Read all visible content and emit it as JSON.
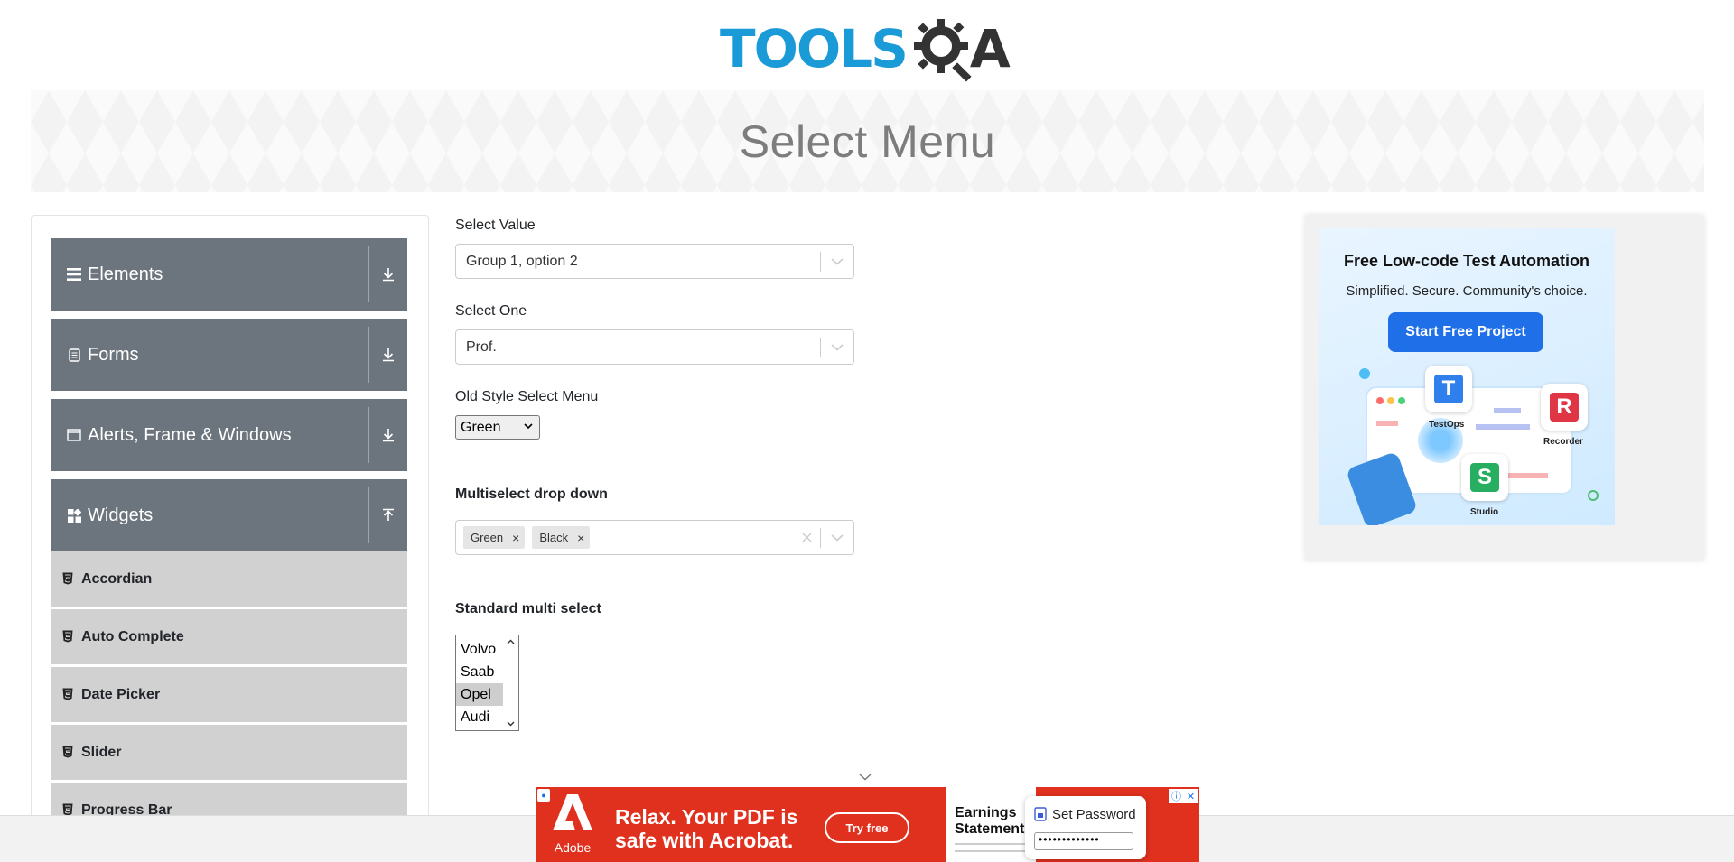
{
  "header": {
    "logo_text": "TOOLS",
    "logo_suffix": "A",
    "page_title": "Select Menu"
  },
  "sidebar": {
    "groups": [
      {
        "label": "Elements",
        "icon": "hamburger-icon",
        "expanded": false
      },
      {
        "label": "Forms",
        "icon": "form-icon",
        "expanded": false
      },
      {
        "label": "Alerts, Frame & Windows",
        "icon": "window-icon",
        "expanded": false
      },
      {
        "label": "Widgets",
        "icon": "widgets-icon",
        "expanded": true
      }
    ],
    "widget_items": [
      "Accordian",
      "Auto Complete",
      "Date Picker",
      "Slider",
      "Progress Bar"
    ]
  },
  "form": {
    "select_value": {
      "label": "Select Value",
      "value": "Group 1, option 2"
    },
    "select_one": {
      "label": "Select One",
      "value": "Prof."
    },
    "old_style": {
      "label": "Old Style Select Menu",
      "value": "Green"
    },
    "multiselect": {
      "label": "Multiselect drop down",
      "chips": [
        "Green",
        "Black"
      ]
    },
    "standard_multi": {
      "label": "Standard multi select",
      "options": [
        "Volvo",
        "Saab",
        "Opel",
        "Audi"
      ],
      "selected": "Opel"
    }
  },
  "ad_right": {
    "title": "Free Low-code Test Automation",
    "subtitle": "Simplified. Secure. Community's choice.",
    "button": "Start Free Project",
    "apps": [
      "TestOps",
      "Recorder",
      "Studio"
    ]
  },
  "ad_bottom": {
    "brand": "Adobe",
    "headline_1": "Relax. Your PDF is",
    "headline_2": "safe with Acrobat.",
    "cta": "Try free",
    "doc_title_1": "Earnings",
    "doc_title_2": "Statement",
    "password_title": "Set Password",
    "password_value": "•••••••••••••"
  },
  "colors": {
    "brand_blue": "#1a9ad6",
    "sidebar_group": "#6c757d",
    "sidebar_item": "#d1d1d1",
    "ad_button": "#1f6fe8",
    "acrobat_red": "#e0311f"
  }
}
